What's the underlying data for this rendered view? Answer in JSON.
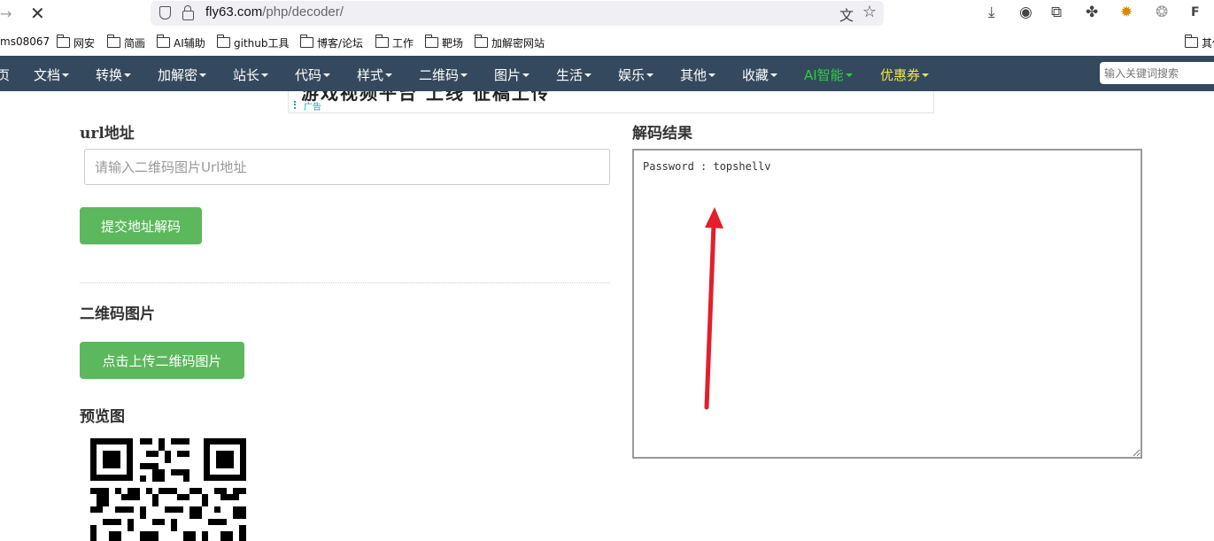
{
  "browser": {
    "url_host": "fly63.com",
    "url_path": "/php/decoder/",
    "toolbar_icons": [
      "download-icon",
      "account-icon",
      "extensions-icon",
      "extension-puzzle-icon",
      "extension-bee-icon",
      "extension-swirl-icon",
      "extension-ff-icon"
    ]
  },
  "bookmarks": [
    {
      "label": "ms08067",
      "folder": false
    },
    {
      "label": "网安",
      "folder": true
    },
    {
      "label": "简画",
      "folder": true
    },
    {
      "label": "AI辅助",
      "folder": true
    },
    {
      "label": "github工具",
      "folder": true
    },
    {
      "label": "博客/论坛",
      "folder": true
    },
    {
      "label": "工作",
      "folder": true
    },
    {
      "label": "靶场",
      "folder": true
    },
    {
      "label": "加解密网站",
      "folder": true
    },
    {
      "label": "其他",
      "folder": true
    }
  ],
  "nav": {
    "items": [
      "页",
      "文档",
      "转换",
      "加解密",
      "站长",
      "代码",
      "样式",
      "二维码",
      "图片",
      "生活",
      "娱乐",
      "其他",
      "收藏",
      "AI智能",
      "优惠券"
    ],
    "search_placeholder": "输入关键词搜索",
    "colors": {
      "bar": "#34495e",
      "ai": "#2ecc40",
      "coupon": "#f1e54a"
    }
  },
  "ad": {
    "text": "游戏视频平台 上线 征稿上传",
    "label": "广告"
  },
  "form": {
    "url_label": "url地址",
    "url_placeholder": "请输入二维码图片Url地址",
    "submit_button": "提交地址解码",
    "qr_label": "二维码图片",
    "upload_button": "点击上传二维码图片",
    "preview_label": "预览图"
  },
  "result": {
    "label": "解码结果",
    "text": "Password : topshellv"
  },
  "colors": {
    "button": "#5cb85c",
    "annotation_arrow": "#e41e2b"
  }
}
